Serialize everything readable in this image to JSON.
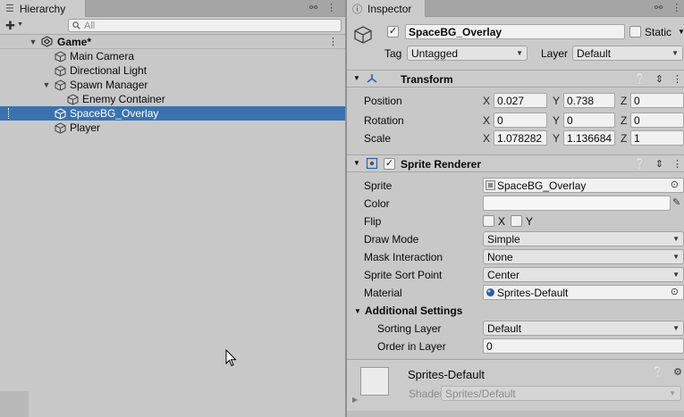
{
  "hierarchy": {
    "tab_title": "Hierarchy",
    "search_placeholder": "All",
    "scene_name": "Game*",
    "items": [
      {
        "label": "Main Camera"
      },
      {
        "label": "Directional Light"
      },
      {
        "label": "Spawn Manager"
      },
      {
        "label": "Enemy Container"
      },
      {
        "label": "SpaceBG_Overlay"
      },
      {
        "label": "Player"
      }
    ],
    "selected_color": "#3a72b0"
  },
  "inspector": {
    "tab_title": "Inspector",
    "object_name": "SpaceBG_Overlay",
    "static_label": "Static",
    "tag_label": "Tag",
    "tag_value": "Untagged",
    "layer_label": "Layer",
    "layer_value": "Default",
    "transform": {
      "title": "Transform",
      "position_label": "Position",
      "rotation_label": "Rotation",
      "scale_label": "Scale",
      "axes": {
        "x": "X",
        "y": "Y",
        "z": "Z"
      },
      "position": {
        "x": "0.027",
        "y": "0.738",
        "z": "0"
      },
      "rotation": {
        "x": "0",
        "y": "0",
        "z": "0"
      },
      "scale": {
        "x": "1.078282",
        "y": "1.136684",
        "z": "1"
      }
    },
    "sprite_renderer": {
      "title": "Sprite Renderer",
      "sprite_label": "Sprite",
      "sprite_value": "SpaceBG_Overlay",
      "color_label": "Color",
      "flip_label": "Flip",
      "flip_x": "X",
      "flip_y": "Y",
      "draw_mode_label": "Draw Mode",
      "draw_mode_value": "Simple",
      "mask_label": "Mask Interaction",
      "mask_value": "None",
      "sort_point_label": "Sprite Sort Point",
      "sort_point_value": "Center",
      "material_label": "Material",
      "material_value": "Sprites-Default",
      "additional_label": "Additional Settings",
      "sorting_layer_label": "Sorting Layer",
      "sorting_layer_value": "Default",
      "order_label": "Order in Layer",
      "order_value": "0"
    },
    "material": {
      "name": "Sprites-Default",
      "shader_label": "Shader",
      "shader_value": "Sprites/Default"
    }
  }
}
